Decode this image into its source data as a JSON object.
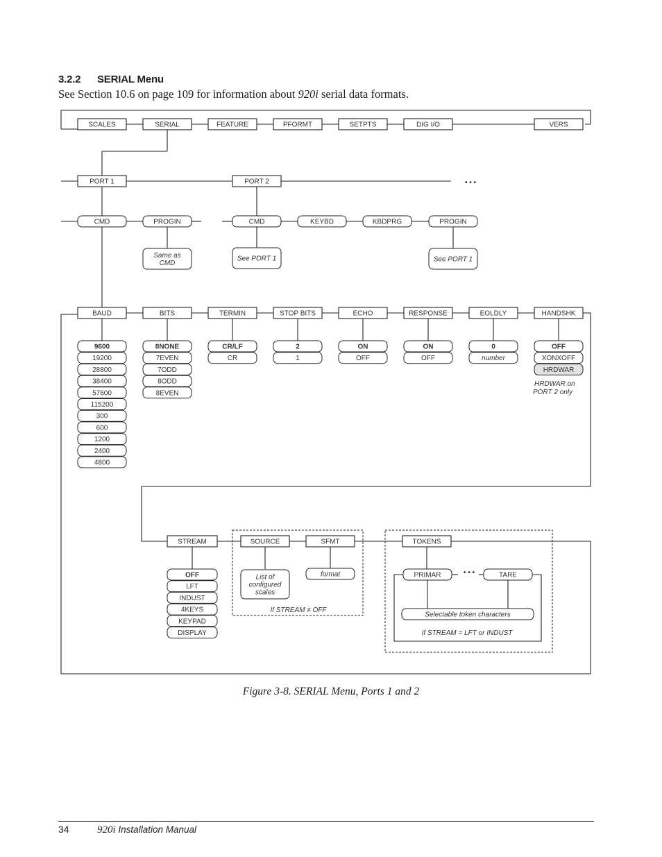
{
  "section": {
    "number": "3.2.2",
    "title": "SERIAL Menu",
    "intro_before": "See Section 10.6 on page 109 for information about ",
    "intro_product": "920i",
    "intro_after": " serial data formats."
  },
  "diagram": {
    "top_menu": [
      "SCALES",
      "SERIAL",
      "FEATURE",
      "PFORMT",
      "SETPTS",
      "DIG I/O",
      "VERS"
    ],
    "ports": [
      "PORT 1",
      "PORT 2"
    ],
    "more_indicator": "• • •",
    "port1_submenu": [
      "CMD",
      "PROGIN"
    ],
    "port1_progin_note": [
      "Same as",
      "CMD"
    ],
    "port2_submenu": [
      "CMD",
      "KEYBD",
      "KBDPRG",
      "PROGIN"
    ],
    "port2_cmd_note": "See PORT 1",
    "port2_progin_note": "See PORT 1",
    "cmd_params": [
      {
        "label": "BAUD",
        "options": [
          "9600",
          "19200",
          "28800",
          "38400",
          "57600",
          "115200",
          "300",
          "600",
          "1200",
          "2400",
          "4800"
        ],
        "default_index": 0
      },
      {
        "label": "BITS",
        "options": [
          "8NONE",
          "7EVEN",
          "7ODD",
          "8ODD",
          "8EVEN"
        ],
        "default_index": 0
      },
      {
        "label": "TERMIN",
        "options": [
          "CR/LF",
          "CR"
        ],
        "default_index": 0
      },
      {
        "label": "STOP BITS",
        "options": [
          "2",
          "1"
        ],
        "default_index": 0
      },
      {
        "label": "ECHO",
        "options": [
          "ON",
          "OFF"
        ],
        "default_index": 0
      },
      {
        "label": "RESPONSE",
        "options": [
          "ON",
          "OFF"
        ],
        "default_index": 0
      },
      {
        "label": "EOLDLY",
        "options": [
          "0",
          "number"
        ],
        "default_index": 0,
        "italic_index": 1
      },
      {
        "label": "HANDSHK",
        "options": [
          "OFF",
          "XONXOFF",
          "HRDWAR"
        ],
        "default_index": 0,
        "shaded_index": 2
      }
    ],
    "handshk_note": [
      "HRDWAR on",
      "PORT 2 only"
    ],
    "stream": {
      "label": "STREAM",
      "options": [
        "OFF",
        "LFT",
        "INDUST",
        "4KEYS",
        "KEYPAD",
        "DISPLAY"
      ],
      "default_index": 0
    },
    "source": {
      "label": "SOURCE",
      "note": [
        "List of",
        "configured",
        "scales"
      ]
    },
    "sfmt": {
      "label": "SFMT",
      "note": "format"
    },
    "stream_condition": "If STREAM ≠ OFF",
    "tokens": {
      "label": "TOKENS",
      "first": "PRIMAR",
      "last": "TARE",
      "ellipsis": "• • •",
      "note": "Selectable token characters",
      "condition": "If STREAM = LFT or INDUST"
    },
    "colors": {
      "line": "#222222",
      "text": "#333333",
      "shaded": "#e2e2e2"
    }
  },
  "caption": "Figure 3-8. SERIAL Menu, Ports 1 and 2",
  "footer": {
    "page": "34",
    "product": "920i",
    "title": " Installation Manual"
  }
}
